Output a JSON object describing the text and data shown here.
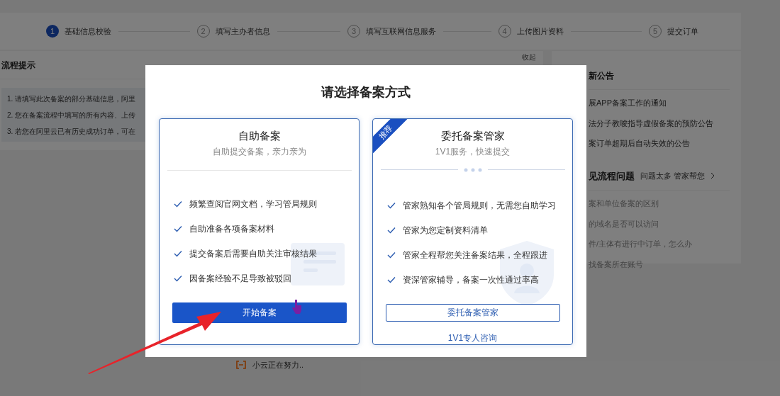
{
  "steps": [
    {
      "number": "1",
      "label": "基础信息校验",
      "selected": true
    },
    {
      "number": "2",
      "label": "填写主办者信息",
      "selected": false
    },
    {
      "number": "3",
      "label": "填写互联网信息服务",
      "selected": false
    },
    {
      "number": "4",
      "label": "上传图片资料",
      "selected": false
    },
    {
      "number": "5",
      "label": "提交订单",
      "selected": false
    }
  ],
  "process_tips": {
    "title": "流程提示",
    "collapse": "收起",
    "lines": [
      "1. 请填写此次备案的部分基础信息，阿里",
      "2. 您在备案流程中填写的所有内容、上传",
      "3. 若您在阿里云已有历史成功订单，可在"
    ]
  },
  "announcements": {
    "title": "新公告",
    "items": [
      "展APP备案工作的通知",
      "法分子教唆指导虚假备案的预防公告",
      "案订单超期后自动失效的公告"
    ]
  },
  "faq": {
    "title": "见流程问题",
    "link": "问题太多 管家帮您",
    "items": [
      "案和单位备案的区别",
      "的域名是否可以访问",
      "件/主体有进行中订单，怎么办",
      "找备案所在账号"
    ]
  },
  "loading": "小云正在努力..",
  "dialog": {
    "title": "请选择备案方式",
    "options": [
      {
        "kind": "self",
        "title": "自助备案",
        "subtitle": "自助提交备案，亲力亲为",
        "features": [
          "频繁查阅官网文档，学习管局规则",
          "自助准备各项备案材料",
          "提交备案后需要自助关注审核结果",
          "因备案经验不足导致被驳回"
        ],
        "button": "开始备案"
      },
      {
        "kind": "managed",
        "ribbon": "推荐",
        "title": "委托备案管家",
        "subtitle": "1V1服务，快速提交",
        "features": [
          "管家熟知各个管局规则，无需您自助学习",
          "管家为您定制资料清单",
          "管家全程帮您关注备案结果，全程跟进",
          "资深管家辅导，备案一次性通过率高"
        ],
        "button": "委托备案管家",
        "link": "1V1专人咨询"
      }
    ]
  }
}
